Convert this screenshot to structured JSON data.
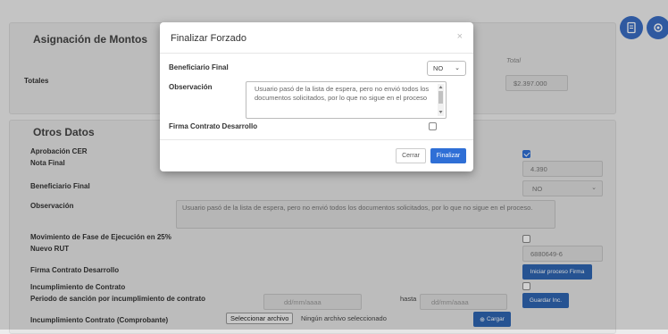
{
  "montos": {
    "title": "Asignación de Montos",
    "col_total": "Total",
    "totales_label": "Totales",
    "totales_value": "$2.397.000"
  },
  "otros": {
    "title": "Otros Datos",
    "aprobacion_cer": "Aprobación CER",
    "nota_final": "Nota Final",
    "nota_final_value": "4.390",
    "beneficiario_final": "Beneficiario Final",
    "beneficiario_value": "NO",
    "observacion": "Observación",
    "observacion_value": "Usuario pasó de la lista de espera, pero no envió todos los documentos solicitados, por lo que no sigue en el proceso.",
    "movimiento_fase": "Movimiento de Fase de Ejecución en 25%",
    "nuevo_rut": "Nuevo RUT",
    "nuevo_rut_value": "6880649-6",
    "firma_contrato": "Firma Contrato Desarrollo",
    "iniciar_firma": "Iniciar proceso Firma",
    "incumplimiento": "Incumplimiento de Contrato",
    "periodo_sancion": "Periodo de sanción por incumplimiento de contrato",
    "date_placeholder": "dd/mm/aaaa",
    "hasta": "hasta",
    "guardar_inc": "Guardar Inc.",
    "incumplimiento_comprobante": "Incumplimiento Contrato (Comprobante)",
    "seleccionar_archivo": "Seleccionar archivo",
    "ningun_archivo": "Ningún archivo seleccionado",
    "cargar": "Cargar"
  },
  "modal": {
    "title": "Finalizar Forzado",
    "close": "×",
    "beneficiario_label": "Beneficiario Final",
    "beneficiario_value": "NO",
    "observacion_label": "Observación",
    "observacion_value": "Usuario pasó de la lista de espera, pero no envió todos los documentos solicitados, por lo que no sigue en el proceso",
    "firma_label": "Firma Contrato Desarrollo",
    "cerrar": "Cerrar",
    "finalizar": "Finalizar"
  },
  "colors": {
    "primary": "#2f6fd6",
    "button_dark": "#2f66b3"
  }
}
